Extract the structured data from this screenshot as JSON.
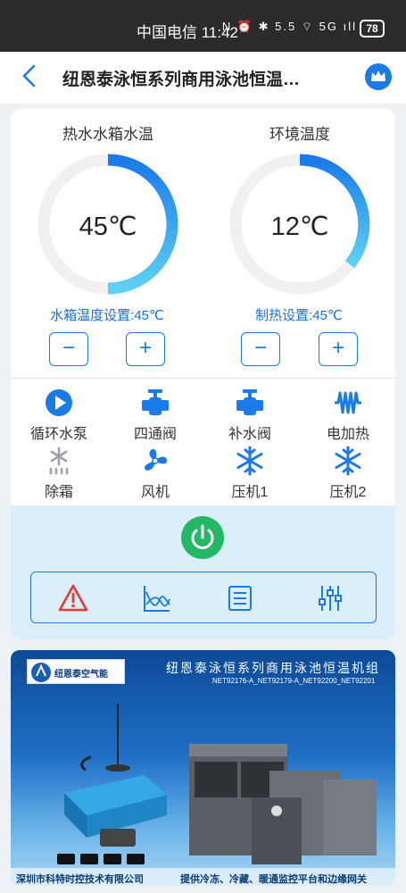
{
  "status_bar": {
    "carrier_time": "中国电信 11:42",
    "icons": "N ⏰ ✱ 5.5 ⌔ 5G ıll",
    "battery": "78"
  },
  "header": {
    "title": "纽恩泰泳恒系列商用泳池恒温…"
  },
  "gauges": {
    "water_tank": {
      "title": "热水水箱水温",
      "value": "45℃",
      "setting": "水箱温度设置:45℃"
    },
    "ambient": {
      "title": "环境温度",
      "value": "12℃",
      "setting": "制热设置:45℃"
    }
  },
  "controls": {
    "minus": "−",
    "plus": "+"
  },
  "devices": [
    {
      "label": "循环水泵",
      "icon": "circulation-pump-icon"
    },
    {
      "label": "四通阀",
      "icon": "four-way-valve-icon"
    },
    {
      "label": "补水阀",
      "icon": "water-refill-valve-icon"
    },
    {
      "label": "电加热",
      "icon": "electric-heater-icon"
    },
    {
      "label": "除霜",
      "icon": "defrost-icon"
    },
    {
      "label": "风机",
      "icon": "fan-icon"
    },
    {
      "label": "压机1",
      "icon": "compressor-snowflake-icon"
    },
    {
      "label": "压机2",
      "icon": "compressor-snowflake-icon"
    }
  ],
  "banner": {
    "logo_text": "纽恩泰空气能",
    "title": "纽恩泰泳恒系列商用泳池恒温机组",
    "models": "NET92176-A_NET92179-A_NET92200_NET92201",
    "company": "深圳市科特时控技术有限公司",
    "slogan": "提供冷冻、冷藏、暖通监控平台和边缘网关"
  },
  "colors": {
    "accent": "#1a7be8",
    "power": "#22b866",
    "alert": "#e53935",
    "gauge_track": "#f0f0f0"
  }
}
